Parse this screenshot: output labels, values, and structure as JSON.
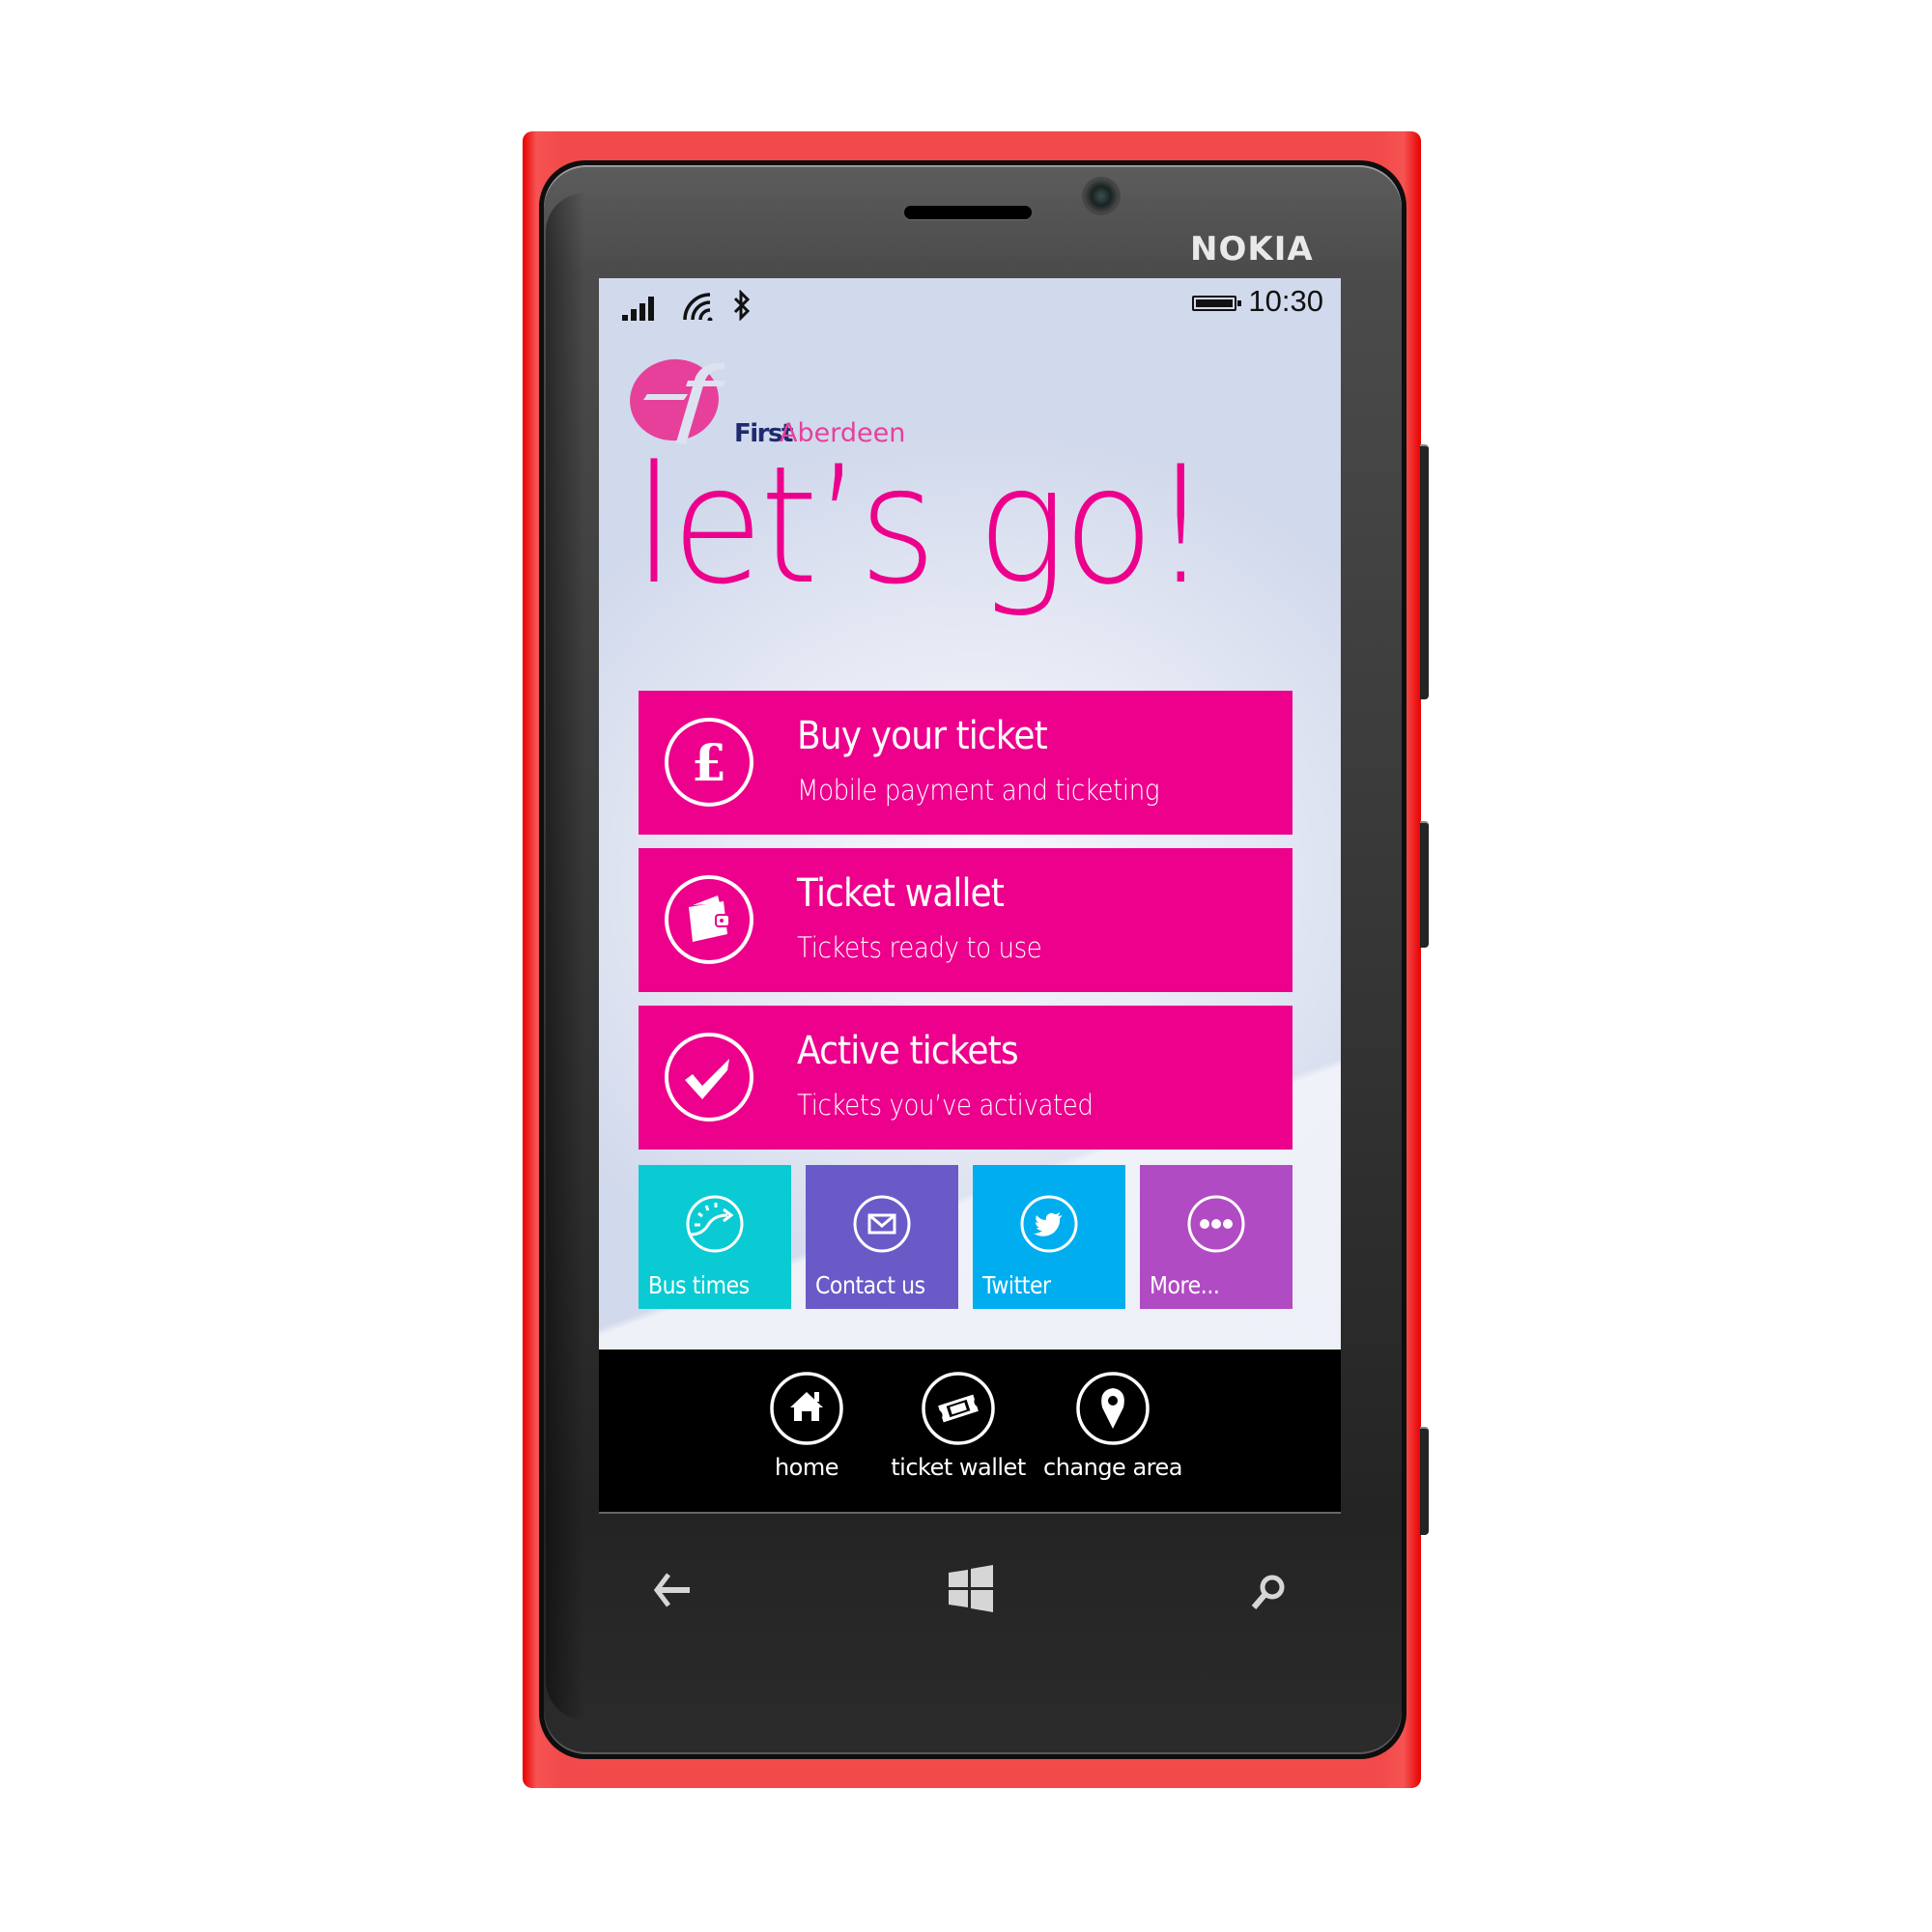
{
  "device": {
    "brand": "NOKIA",
    "hardware_buttons": [
      {
        "name": "back",
        "icon": "back-arrow-icon"
      },
      {
        "name": "start",
        "icon": "windows-logo-icon"
      },
      {
        "name": "search",
        "icon": "search-icon"
      }
    ]
  },
  "status_bar": {
    "icons": [
      "signal-strength-icon",
      "wifi-icon",
      "bluetooth-icon"
    ],
    "battery_icon": "battery-icon",
    "time": "10:30"
  },
  "app": {
    "logo": {
      "brand_word": "First",
      "area_word": "Aberdeen",
      "colors": {
        "brand": "#1f2a6e",
        "accent": "#e6409b"
      }
    },
    "heading": "let’s go!",
    "accent_color": "#ec008c",
    "main_tiles": [
      {
        "title": "Buy your ticket",
        "subtitle": "Mobile payment and ticketing",
        "icon": "pound-coin-icon"
      },
      {
        "title": "Ticket wallet",
        "subtitle": "Tickets ready to use",
        "icon": "wallet-icon"
      },
      {
        "title": "Active tickets",
        "subtitle": "Tickets you’ve activated",
        "icon": "checkmark-icon"
      }
    ],
    "small_tiles": [
      {
        "label": "Bus times",
        "icon": "timer-icon",
        "color": "#0acbd3"
      },
      {
        "label": "Contact us",
        "icon": "envelope-icon",
        "color": "#6a5ac8"
      },
      {
        "label": "Twitter",
        "icon": "twitter-bird-icon",
        "color": "#00aeef"
      },
      {
        "label": "More...",
        "icon": "more-dots-icon",
        "color": "#b14bc4"
      }
    ],
    "app_bar": [
      {
        "label": "home",
        "icon": "home-icon"
      },
      {
        "label": "ticket wallet",
        "icon": "ticket-icon"
      },
      {
        "label": "change area",
        "icon": "map-pin-icon"
      }
    ]
  }
}
